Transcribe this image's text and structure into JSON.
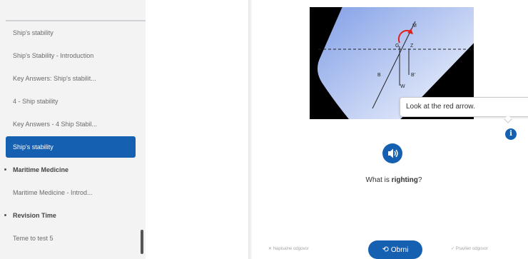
{
  "sidebar": {
    "items": [
      {
        "label": "Ship's stability",
        "type": "item"
      },
      {
        "label": "Ship's Stability - Introduction",
        "type": "item"
      },
      {
        "label": "Key Answers: Ship's stabilit...",
        "type": "item"
      },
      {
        "label": "4 - Ship stability",
        "type": "item"
      },
      {
        "label": "Key Answers - 4 Ship Stabil...",
        "type": "item"
      },
      {
        "label": "Ship's stability",
        "type": "active"
      },
      {
        "label": "Maritime Medicine",
        "type": "section"
      },
      {
        "label": "Maritime Medicine - Introd...",
        "type": "item"
      },
      {
        "label": "Revision Time",
        "type": "section"
      },
      {
        "label": "Teme to test 5",
        "type": "item"
      }
    ]
  },
  "diagram": {
    "labels": {
      "M": "M",
      "G": "G",
      "Z": "Z",
      "B": "B",
      "B1": "B'",
      "W": "W"
    }
  },
  "tooltip": {
    "text": "Look at the red arrow."
  },
  "info": {
    "glyph": "i"
  },
  "question": {
    "prefix": "What is ",
    "keyword": "righting",
    "suffix": "?"
  },
  "controls": {
    "prev_label": "Napisalne odgovor",
    "main_label": "Obrni",
    "next_label": "Pravilen odgovor"
  },
  "colors": {
    "accent": "#1660b2",
    "highlight": "#e02020"
  }
}
